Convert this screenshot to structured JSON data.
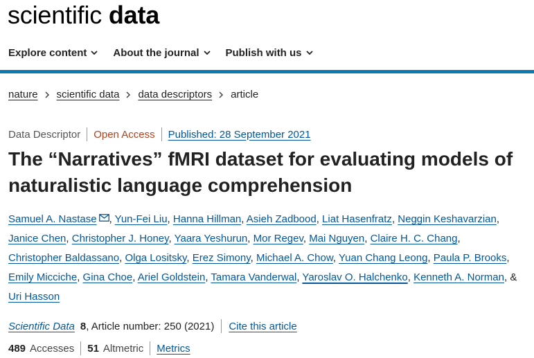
{
  "logo": {
    "light": "scientific",
    "bold": "data"
  },
  "nav": {
    "items": [
      {
        "label": "Explore content"
      },
      {
        "label": "About the journal"
      },
      {
        "label": "Publish with us"
      }
    ]
  },
  "accent_color": "#0d7ab2",
  "breadcrumb": {
    "items": [
      "nature",
      "scientific data",
      "data descriptors"
    ],
    "current": "article"
  },
  "article_meta": {
    "type": "Data Descriptor",
    "access": "Open Access",
    "published": "Published: 28 September 2021"
  },
  "title": "The “Narratives” fMRI dataset for evaluating models of naturalistic language comprehension",
  "authors": [
    "Samuel A. Nastase",
    "Yun-Fei Liu",
    "Hanna Hillman",
    "Asieh Zadbood",
    "Liat Hasenfratz",
    "Neggin Keshavarzian",
    "Janice Chen",
    "Christopher J. Honey",
    "Yaara Yeshurun",
    "Mor Regev",
    "Mai Nguyen",
    "Claire H. C. Chang",
    "Christopher Baldassano",
    "Olga Lositsky",
    "Erez Simony",
    "Michael A. Chow",
    "Yuan Chang Leong",
    "Paula P. Brooks",
    "Emily Micciche",
    "Gina Choe",
    "Ariel Goldstein",
    "Tamara Vanderwal",
    "Yaroslav O. Halchenko",
    "Kenneth A. Norman",
    "Uri Hasson"
  ],
  "author_sep": ", ",
  "author_and": "& ",
  "citation": {
    "journal": "Scientific Data",
    "volume": "8",
    "details": ", Article number: 250 (2021)",
    "cite_link": "Cite this article"
  },
  "metrics": {
    "accesses_count": "489",
    "accesses_label": "Accesses",
    "altmetric_count": "51",
    "altmetric_label": "Altmetric",
    "metrics_link": "Metrics"
  }
}
